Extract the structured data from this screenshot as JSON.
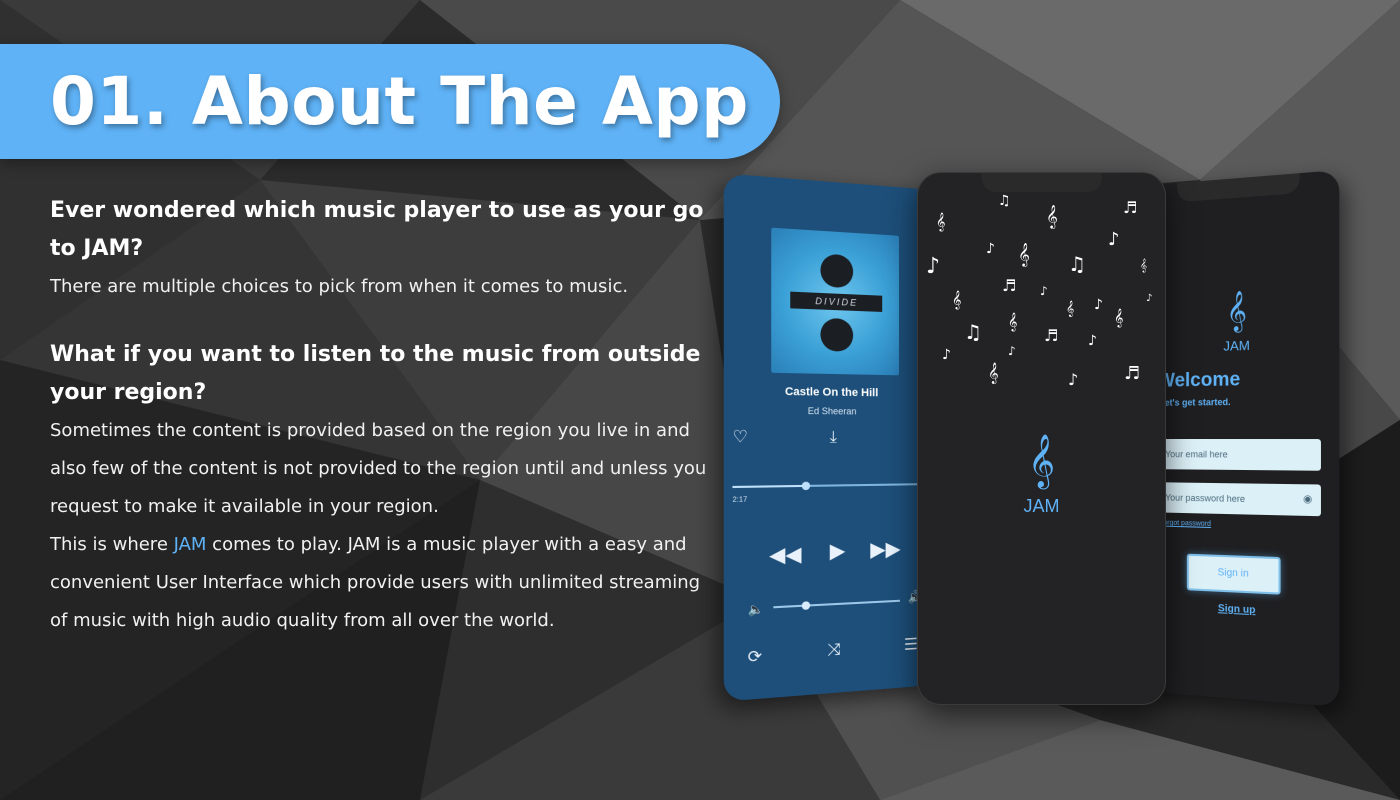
{
  "banner": {
    "title": "01. About The App"
  },
  "content": {
    "heading1": "Ever wondered which music player to use as your go to JAM?",
    "para1": "There are multiple choices to pick from when it comes to music.",
    "heading2": "What if you want to listen to the music from outside your region?",
    "para2": "Sometimes the content is provided based on the region you live in and also few of the content is not provided to the region until and unless you request to make it available in your region.",
    "para3_prefix": "This is where ",
    "para3_accent": "JAM",
    "para3_suffix": " comes to play. JAM is a music player with a easy and convenient User Interface which provide users with unlimited streaming of music with high audio quality from all over the world."
  },
  "player": {
    "album_text": "DIVIDE",
    "song_title": "Castle On the Hill",
    "artist": "Ed Sheeran",
    "elapsed": "2:17",
    "progress": 0.35,
    "volume": 0.25,
    "icons": {
      "like": "heart-icon",
      "download": "download-icon",
      "rewind": "rewind-icon",
      "play": "play-icon",
      "forward": "fast-forward-icon",
      "volume_low": "volume-low-icon",
      "volume_high": "volume-high-icon",
      "repeat": "repeat-icon",
      "shuffle": "shuffle-icon",
      "queue": "queue-icon"
    }
  },
  "splash": {
    "app_name": "JAM",
    "icon": "treble-clef-icon"
  },
  "login": {
    "app_name": "JAM",
    "welcome": "Welcome",
    "subtitle": "Let's get started.",
    "email_placeholder": "Your email here",
    "password_placeholder": "Your password here",
    "forgot": "Forgot password",
    "signin": "Sign in",
    "signup": "Sign up"
  },
  "colors": {
    "accent": "#5fb2f6",
    "player_bg": "#1d4f7a",
    "dark_phone": "#232325"
  }
}
